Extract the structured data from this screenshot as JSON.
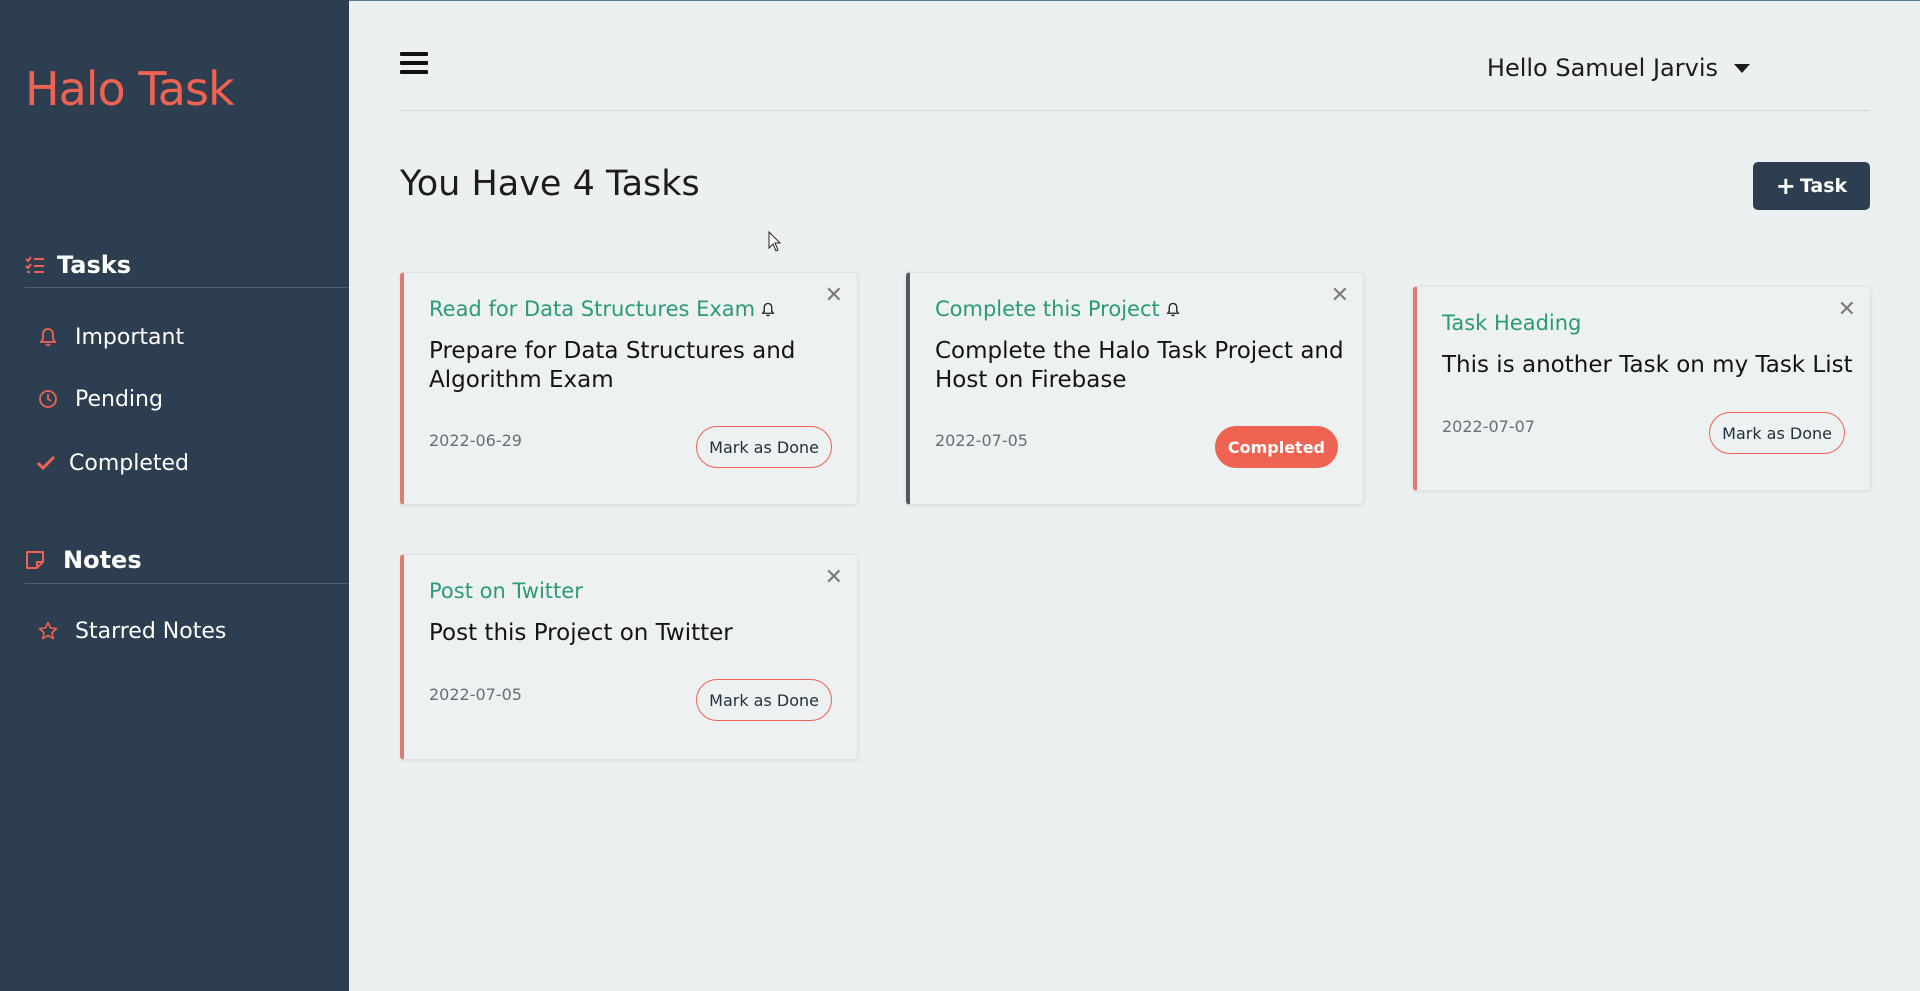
{
  "app": {
    "brand": "Halo Task",
    "colors": {
      "sidebar": "#2d3e50",
      "accent": "#ee6352",
      "heading": "#2a9a78"
    }
  },
  "sidebar": {
    "tasks_section": {
      "label": "Tasks",
      "icon": "list-check-icon"
    },
    "task_items": [
      {
        "label": "Important",
        "icon": "bell-icon"
      },
      {
        "label": "Pending",
        "icon": "clock-icon"
      },
      {
        "label": "Completed",
        "icon": "check-icon"
      }
    ],
    "notes_section": {
      "label": "Notes",
      "icon": "sticky-note-icon"
    },
    "note_items": [
      {
        "label": "Starred Notes",
        "icon": "star-icon"
      }
    ]
  },
  "header": {
    "menu_icon": "hamburger-icon",
    "greeting": "Hello Samuel Jarvis"
  },
  "main": {
    "title": "You Have 4 Tasks",
    "add_task_label": "Task",
    "tasks": [
      {
        "heading": "Read for Data Structures Exam",
        "important": true,
        "description": "Prepare for Data Structures and Algorithm Exam",
        "date": "2022-06-29",
        "action": "Mark as Done",
        "completed": false
      },
      {
        "heading": "Complete this Project",
        "important": true,
        "description": "Complete the Halo Task Project and Host on Firebase",
        "date": "2022-07-05",
        "action": "Completed",
        "completed": true
      },
      {
        "heading": "Task Heading",
        "important": false,
        "description": "This is another Task on my Task List",
        "date": "2022-07-07",
        "action": "Mark as Done",
        "completed": false
      },
      {
        "heading": "Post on Twitter",
        "important": false,
        "description": "Post this Project on Twitter",
        "date": "2022-07-05",
        "action": "Mark as Done",
        "completed": false
      }
    ]
  }
}
